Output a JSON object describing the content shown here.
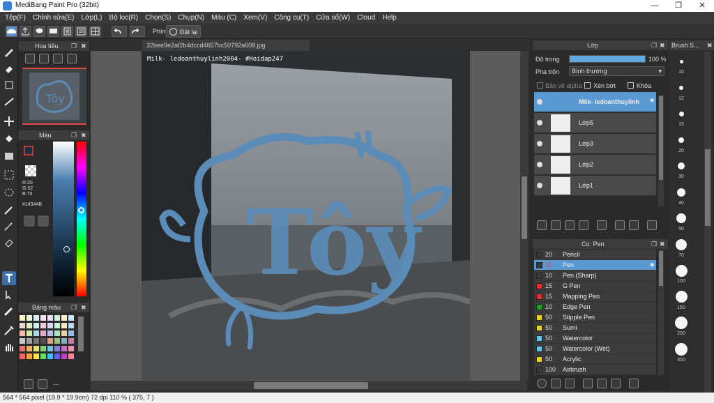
{
  "window": {
    "title": "MediBang Paint Pro (32bit)",
    "minimize": "—",
    "maximize": "❐",
    "close": "✕"
  },
  "menu": [
    "Tệp(F)",
    "Chỉnh sửa(E)",
    "Lớp(L)",
    "Bộ lọc(R)",
    "Chọn(S)",
    "Chụp(N)",
    "Màu (C)",
    "Xem(V)",
    "Công cụ(T)",
    "Cửa sổ(W)",
    "Cloud",
    "Help"
  ],
  "toolbar": {
    "shortcut_label": "Phím",
    "reset_label": "Đặt lại"
  },
  "navigator": {
    "title": "Hoa tiêu"
  },
  "color_panel": {
    "title": "Màu",
    "r": "R:20",
    "g": "G:52",
    "b": "B:75",
    "hex": "#14344B",
    "fg_color": "#14344B"
  },
  "swatch_panel": {
    "title": "Bảng màu",
    "more": "---"
  },
  "document": {
    "tab_name": "32bee9e2af2b4dccd4657bc50792a608.jpg",
    "watermark": "Milk- ledoanthuylinh2004- #Hoidap247",
    "art_text": "Tôy"
  },
  "layers": {
    "title": "Lớp",
    "opacity_label": "Độ trong",
    "opacity_value": "100 %",
    "opacity_fraction": 1.0,
    "blend_label": "Pha trộn",
    "blend_value": "Bình thường",
    "alpha_protect": "Bảo vệ alpha",
    "clip": "Xén bớt",
    "lock": "Khóa",
    "items": [
      {
        "name": "Milk- ledoanthuylinh",
        "selected": true
      },
      {
        "name": "Lớp5",
        "selected": false
      },
      {
        "name": "Lớp3",
        "selected": false
      },
      {
        "name": "Lớp2",
        "selected": false
      },
      {
        "name": "Lớp1",
        "selected": false
      }
    ]
  },
  "brushes": {
    "title": "Cọ: Pen",
    "items": [
      {
        "size": "20",
        "name": "Pencil",
        "color": "#3a3a3a",
        "selected": false
      },
      {
        "size": "10",
        "name": "Pen",
        "color": "#3a3a3a",
        "selected": true
      },
      {
        "size": "10",
        "name": "Pen (Sharp)",
        "color": "#3a3a3a",
        "selected": false
      },
      {
        "size": "15",
        "name": "G Pen",
        "color": "#e03030",
        "selected": false
      },
      {
        "size": "15",
        "name": "Mapping Pen",
        "color": "#e03030",
        "selected": false
      },
      {
        "size": "10",
        "name": "Edge Pen",
        "color": "#20a020",
        "selected": false
      },
      {
        "size": "50",
        "name": "Stipple Pen",
        "color": "#e8d020",
        "selected": false
      },
      {
        "size": "50",
        "name": "Sumi",
        "color": "#e8d020",
        "selected": false
      },
      {
        "size": "50",
        "name": "Watercolor",
        "color": "#60c8f0",
        "selected": false
      },
      {
        "size": "50",
        "name": "Watercolor (Wet)",
        "color": "#60c8f0",
        "selected": false
      },
      {
        "size": "50",
        "name": "Acrylic",
        "color": "#e8d020",
        "selected": false
      },
      {
        "size": "100",
        "name": "Airbrush",
        "color": "#3a3a3a",
        "selected": false
      }
    ]
  },
  "brush_size": {
    "title": "Brush S...",
    "labels": [
      "10",
      "12",
      "15",
      "20",
      "30",
      "40",
      "50",
      "70",
      "100",
      "150",
      "200",
      "300"
    ]
  },
  "status": {
    "text": "564 * 564 pixel   (19.9 * 19.9cm)   72 dpi   110 %   ( 375, 7 )"
  }
}
